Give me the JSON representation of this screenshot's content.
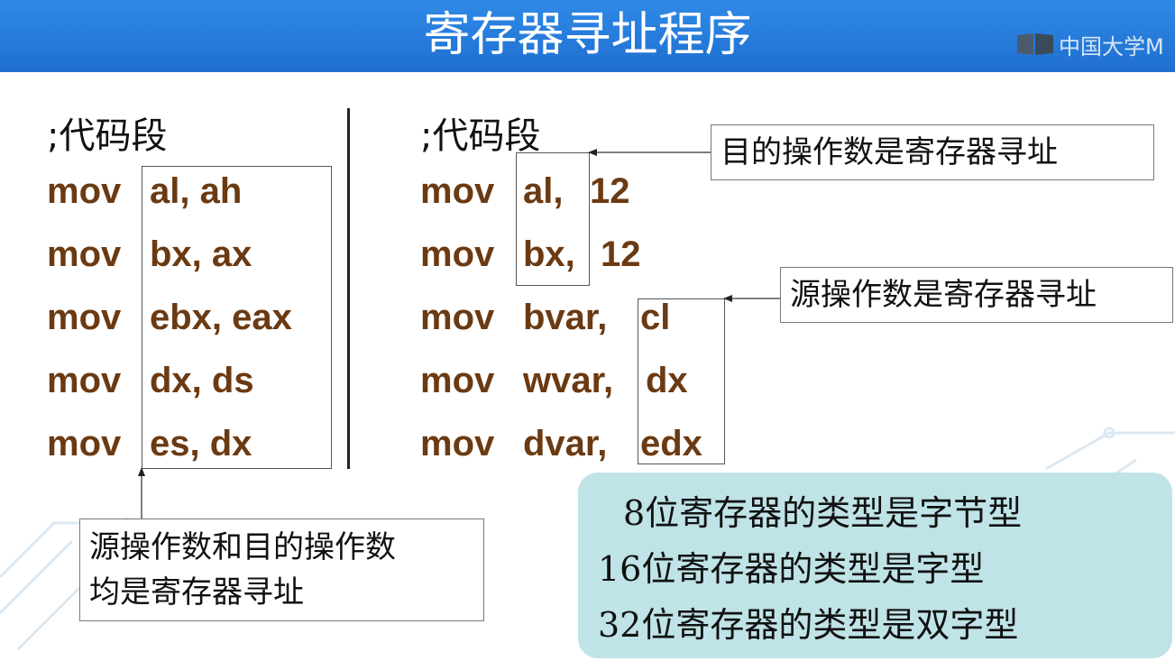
{
  "header": {
    "title": "寄存器寻址程序",
    "logo_text": "中国大学M"
  },
  "left": {
    "comment": ";代码段",
    "lines": [
      {
        "op": "mov",
        "operands": "al, ah"
      },
      {
        "op": "mov",
        "operands": "bx, ax"
      },
      {
        "op": "mov",
        "operands": "ebx, eax"
      },
      {
        "op": "mov",
        "operands": "dx, ds"
      },
      {
        "op": "mov",
        "operands": "es, dx"
      }
    ],
    "callout_line1": "源操作数和目的操作数",
    "callout_line2": "均是寄存器寻址"
  },
  "right": {
    "comment": ";代码段",
    "lines": [
      {
        "op": "mov",
        "dest": "al,",
        "src": "12"
      },
      {
        "op": "mov",
        "dest": "bx,",
        "src": "12"
      },
      {
        "op": "mov",
        "dest": "bvar,",
        "src": "cl"
      },
      {
        "op": "mov",
        "dest": "wvar,",
        "src": "dx"
      },
      {
        "op": "mov",
        "dest": "dvar,",
        "src": "edx"
      }
    ],
    "callout_dest": "目的操作数是寄存器寻址",
    "callout_src": "源操作数是寄存器寻址"
  },
  "summary": {
    "line1": "8位寄存器的类型是字节型",
    "line2": "16位寄存器的类型是字型",
    "line3": "32位寄存器的类型是双字型"
  }
}
